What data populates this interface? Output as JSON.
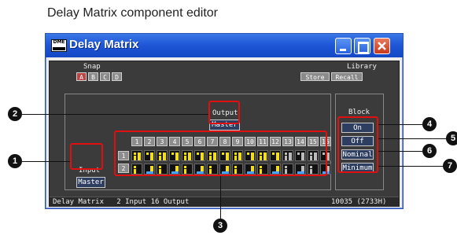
{
  "caption": "Delay Matrix component editor",
  "window": {
    "title": "Delay Matrix",
    "icon": "app-chip-icon"
  },
  "snap": {
    "label": "Snap",
    "buttons": [
      "A",
      "B",
      "C",
      "D"
    ],
    "active": "A"
  },
  "library": {
    "label": "Library",
    "store": "Store",
    "recall": "Recall"
  },
  "output": {
    "label": "Output",
    "button": "Master"
  },
  "input": {
    "label": "Input",
    "button": "Master"
  },
  "block": {
    "label": "Block",
    "buttons": [
      "On",
      "Off",
      "Nominal",
      "Minimum"
    ]
  },
  "channels": [
    "1",
    "2",
    "3",
    "4",
    "5",
    "6",
    "7",
    "8",
    "9",
    "10",
    "11",
    "12",
    "13",
    "14",
    "15",
    "16"
  ],
  "rows": [
    "1",
    "2"
  ],
  "status": {
    "left": "Delay Matrix   2 Input 16 Output",
    "right": "10035 (2733H)"
  },
  "callouts": [
    "1",
    "2",
    "3",
    "4",
    "5",
    "6",
    "7"
  ]
}
